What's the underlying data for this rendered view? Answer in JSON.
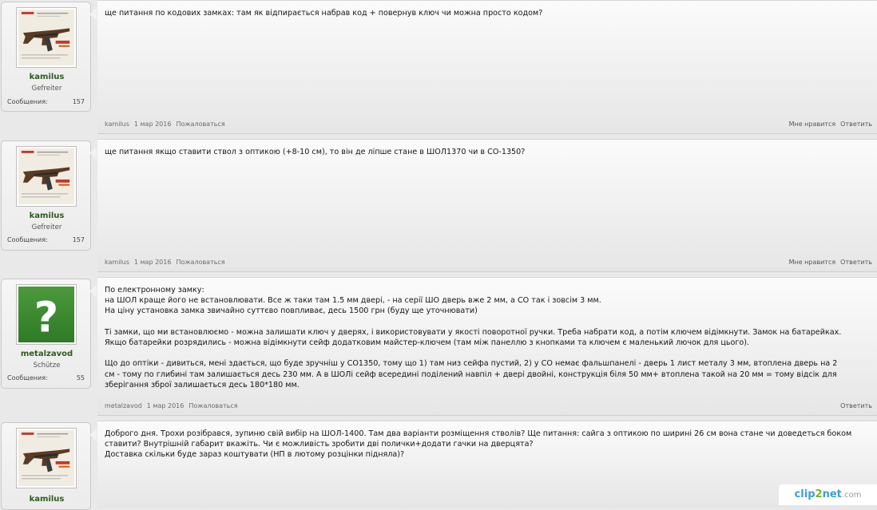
{
  "colors": {
    "username": "#2d5b1f",
    "meta": "#6b6b6b",
    "watermark": "#3a9fd8"
  },
  "posts": [
    {
      "user": {
        "name": "kamilus",
        "rank": "Gefreiter",
        "stat_label": "Сообщения:",
        "stat_value": "157",
        "avatar": "rifle-avatar"
      },
      "text": "ще питання по кодових замках: там як відпирається набрав код + повернув ключ чи можна просто кодом?",
      "meta": {
        "author": "kamilus",
        "date": "1 мар 2016",
        "report": "Пожаловаться"
      },
      "actions": {
        "like": "Мне нравится",
        "reply": "Ответить"
      }
    },
    {
      "user": {
        "name": "kamilus",
        "rank": "Gefreiter",
        "stat_label": "Сообщения:",
        "stat_value": "157",
        "avatar": "rifle-avatar"
      },
      "text": "ще питання якщо ставити ствол з оптикою (+8-10 см), то він де ліпше стане в ШОЛ1370 чи в СО-1350?",
      "meta": {
        "author": "kamilus",
        "date": "1 мар 2016",
        "report": "Пожаловаться"
      },
      "actions": {
        "like": "Мне нравится",
        "reply": "Ответить"
      }
    },
    {
      "user": {
        "name": "metalzavod",
        "rank": "Schütze",
        "stat_label": "Сообщения:",
        "stat_value": "55",
        "avatar": "question-mark-avatar"
      },
      "text": "По електронному замку:\nна ШОЛ краще його не встановлювати. Все ж таки там 1.5 мм двері, - на серії ШО дверь вже 2 мм, а СО так і зовсім 3 мм.\nНа ціну установка замка звичайно суттєво повпливає, десь 1500 грн (буду ще уточнювати)\n\nТі замки, що ми встановлюємо - можна залишати ключ у дверях, і використовувати у якості поворотної ручки. Треба набрати код, а потім ключем відімкнути. Замок на батарейках.\nЯкщо батарейки розрядились - можна відімкнути сейф додатковим майстер-ключем (там між панеллю з кнопками та ключем є маленький лючок для цього).\n\nЩо до оптіки - дивиться, мені здається, що буде зручніш у СО1350, тому що 1) там низ сейфа пустий, 2) у СО немає фальшпанелі - дверь 1 лист металу 3 мм, втоплена дверь на 2\nсм - тому по глибині там залишається десь 230 мм. А в ШОЛі сейф всередині поділений навпіл + двері двойні, конструкція біля 50 мм+ втоплена такой на 20 мм = тому відсік для\nзберігання зброї залишається десь 180*180 мм.",
      "meta": {
        "author": "metalzavod",
        "date": "1 мар 2016",
        "report": "Пожаловаться"
      },
      "actions": {
        "like": "",
        "reply": "Ответить"
      }
    },
    {
      "user": {
        "name": "kamilus",
        "rank": "",
        "stat_label": "",
        "stat_value": "",
        "avatar": "rifle-avatar"
      },
      "text": "Доброго дня. Трохи розібрався, зупиню свій вибір на ШОЛ-1400. Там два варіанти розміщення стволів? Ще питання: сайга з оптикою по ширині 26 см вона стане чи доведеться боком\nставити? Внутрішній габарит вкажіть. Чи є можливість зробити дві полички+додати гачки на дверцята?\nДоставка скільки буде зараз коштувати (НП в лютому розцінки підняла)?",
      "meta": {
        "author": "",
        "date": "",
        "report": ""
      },
      "actions": {
        "like": "",
        "reply": ""
      }
    }
  ],
  "watermark": {
    "part1": "clip",
    "part2": "2",
    "part3": "net",
    "part4": ".com"
  }
}
